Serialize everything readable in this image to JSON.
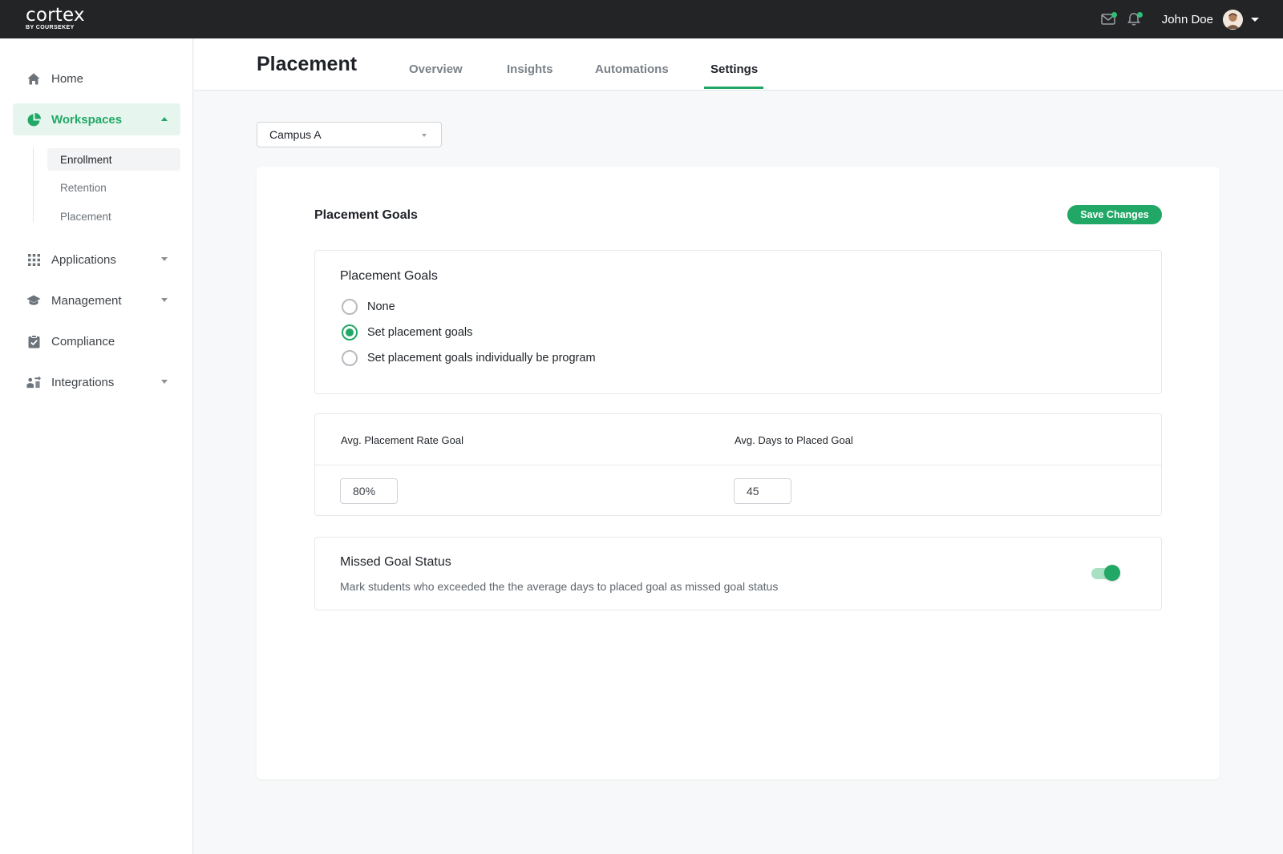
{
  "brand": {
    "name": "cortex",
    "sub": "BY COURSEKEY",
    "accent": "#22a866"
  },
  "topbar": {
    "user_name": "John Doe",
    "mail_icon": "mail-icon",
    "bell_icon": "bell-icon"
  },
  "sidebar": {
    "home": "Home",
    "workspaces": "Workspaces",
    "workspace_items": [
      "Enrollment",
      "Retention",
      "Placement"
    ],
    "applications": "Applications",
    "management": "Management",
    "compliance": "Compliance",
    "integrations": "Integrations"
  },
  "header": {
    "title": "Placement",
    "tabs": [
      "Overview",
      "Insights",
      "Automations",
      "Settings"
    ],
    "active_tab": "Settings"
  },
  "campus_select": {
    "value": "Campus A"
  },
  "card": {
    "title": "Placement Goals",
    "save_label": "Save Changes",
    "goals_panel": {
      "title": "Placement Goals",
      "options": [
        "None",
        "Set placement goals",
        "Set placement goals individually be program"
      ],
      "selected": "Set placement goals"
    },
    "metrics_panel": {
      "rate_label": "Avg. Placement Rate Goal",
      "rate_value": "80%",
      "days_label": "Avg. Days to Placed Goal",
      "days_value": "45"
    },
    "missed_panel": {
      "title": "Missed Goal Status",
      "description": "Mark students who exceeded the the average days to placed goal as missed goal status",
      "toggle_on": true
    }
  }
}
